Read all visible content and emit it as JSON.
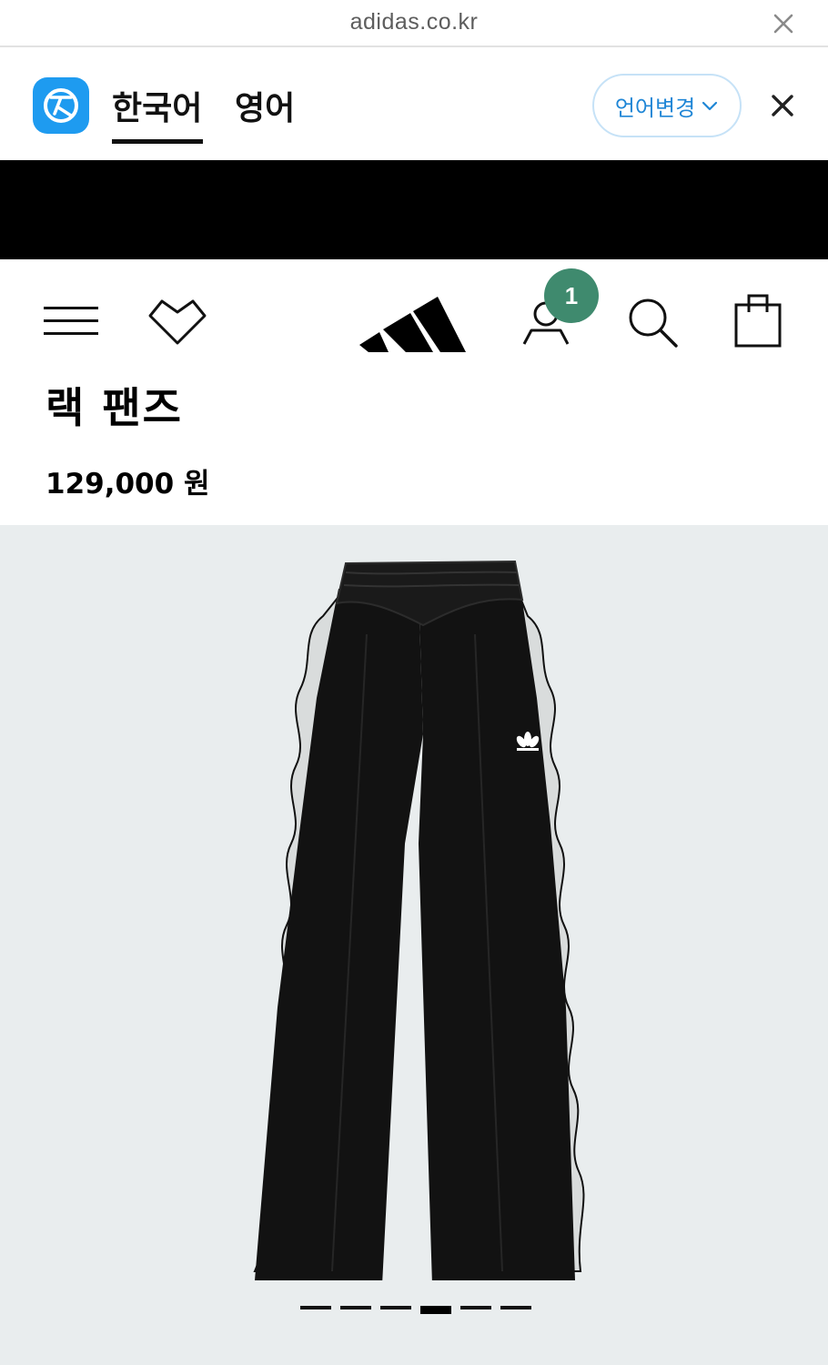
{
  "browser": {
    "url": "adidas.co.kr",
    "close_icon": "close-icon"
  },
  "translate_bar": {
    "logo_icon": "papago-logo-icon",
    "tabs": [
      {
        "label": "한국어",
        "selected": true
      },
      {
        "label": "영어",
        "selected": false
      }
    ],
    "change_language_label": "언어변경",
    "accent_color": "#1f86d6"
  },
  "header": {
    "menu_icon": "hamburger-menu-icon",
    "wishlist_icon": "heart-icon",
    "brand_logo": "adidas-logo",
    "account_icon": "account-icon",
    "account_badge_count": "1",
    "search_icon": "search-icon",
    "bag_icon": "shopping-bag-icon",
    "badge_color": "#3f8a6e"
  },
  "product": {
    "title": "랙 팬즈",
    "price": "129,000 원",
    "image": "black-track-pants-with-ruffled-side-stripes",
    "image_background": "#e9edee"
  },
  "carousel": {
    "slide_count": 6,
    "active_index": 3
  }
}
